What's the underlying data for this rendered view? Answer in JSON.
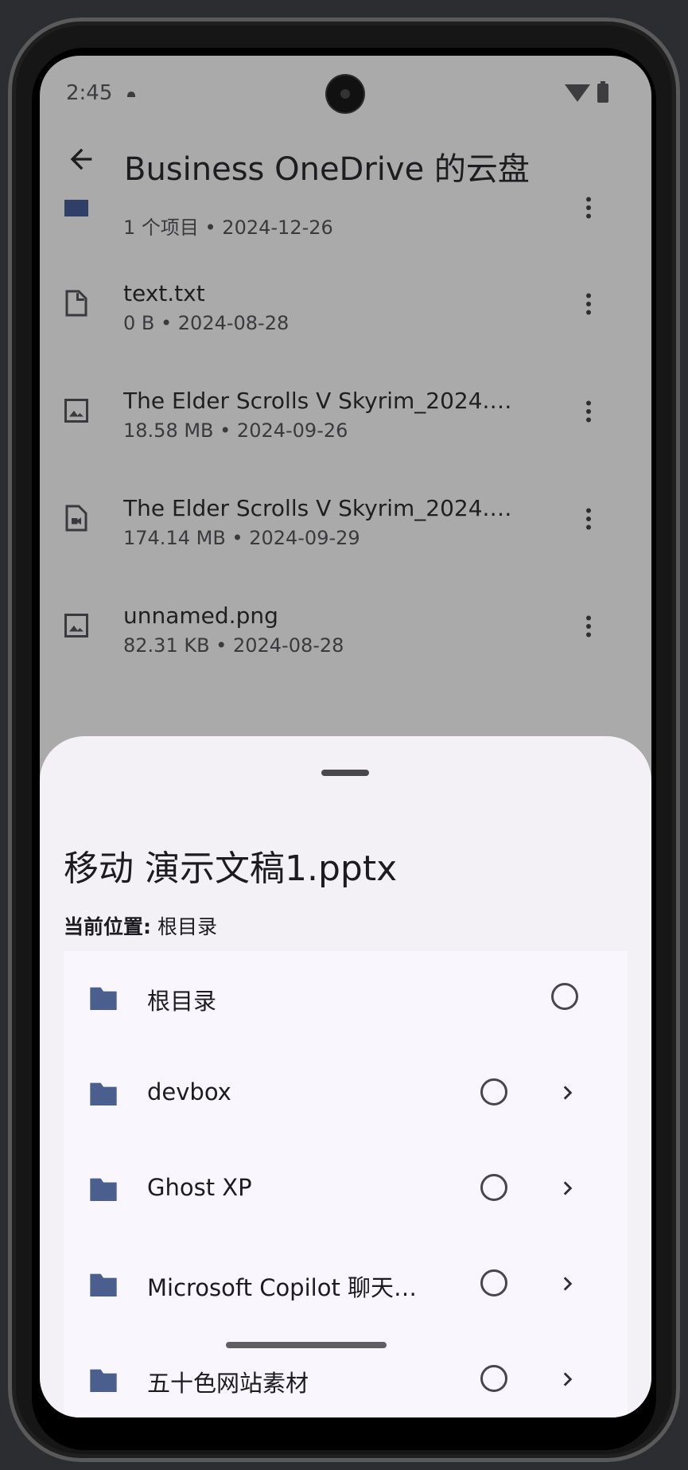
{
  "status": {
    "time": "2:45"
  },
  "appbar": {
    "title": "Business OneDrive 的云盘"
  },
  "files": [
    {
      "name": "",
      "meta": "1 个项目 • 2024-12-26",
      "icon": "folder-icon"
    },
    {
      "name": "text.txt",
      "meta": "0 B • 2024-08-28",
      "icon": "file-icon"
    },
    {
      "name": "The Elder Scrolls V Skyrim_2024.0…",
      "meta": "18.58 MB • 2024-09-26",
      "icon": "image-icon"
    },
    {
      "name": "The Elder Scrolls V Skyrim_2024.0…",
      "meta": "174.14 MB • 2024-09-29",
      "icon": "video-file-icon"
    },
    {
      "name": "unnamed.png",
      "meta": "82.31 KB • 2024-08-28",
      "icon": "image-icon"
    }
  ],
  "sheet": {
    "title": "移动 演示文稿1.pptx",
    "location_label": "当前位置:",
    "location_value": "根目录",
    "folders": [
      {
        "name": "根目录",
        "has_children": false
      },
      {
        "name": "devbox",
        "has_children": true
      },
      {
        "name": "Ghost XP",
        "has_children": true
      },
      {
        "name": "Microsoft Copilot 聊天…",
        "has_children": true
      },
      {
        "name": "五十色网站素材",
        "has_children": true
      }
    ]
  },
  "colors": {
    "folder": "#4a5f8e",
    "scrim": "#aaaaab",
    "sheet": "#f3f1f6"
  }
}
